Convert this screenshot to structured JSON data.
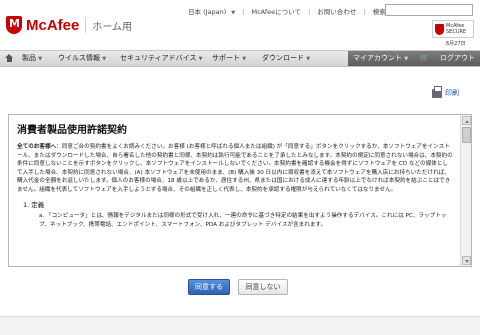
{
  "top_links": {
    "region": "日本 (Japan)",
    "about": "McAfeeについて",
    "contact": "お問い合わせ",
    "search_label": "検索"
  },
  "header": {
    "brand": "McAfee",
    "brand_sub": "ホーム用",
    "secure_line1": "McAfee",
    "secure_line2": "SECURE",
    "secure_date": "6月27日"
  },
  "nav": {
    "items": [
      "製品",
      "ウイルス情報",
      "セキュリティアドバイス",
      "サポート",
      "ダウンロード"
    ],
    "my_account": "マイアカウント",
    "login": "ログアウト"
  },
  "print_label": "印刷",
  "license": {
    "title": "消費者製品使用許諾契約",
    "para1_bold": "全てのお客様へ",
    "para1": "：同意ご合の契約書をよくお読みください。お客様 (お客様と呼ばれる個人または組織) が「同意する」ボタンをクリックするか、本ソフトウェアをインストール、またはダウンロードした場合、自ら署名した他の契約書と同様、本契約は執行可能であることを了承したとみなします。本契約の規定に同意されない場合は、本契約の条件に同意しないことを示すボタンをクリックし、本ソフトウェアをインストールしないでください。本契約書を確認する機会を得ずにソフトウェアを CD などの媒体として入手した場合、本契約に同意されない場合、(A) 本ソフトウェアを未使用のまま、(B) 購入後 30 日以内に領収書を添えて本ソフトウェアを購入店にお持ちいただければ、購入代金の全額をお返しいたします。個人のお客様の場合、18 歳以上であるか、居住する州、県または国における成人に達する年齢以上でなければ本契約を結ぶことはできません。組織を代表してソフトウェアを入手しようとする場合、その組織を正しく代表し、本契約を承認する権限が与えられていなくてはなりません。",
    "section1": "1.  定義",
    "item_a": "a. 「コンピュータ」とは、情報をデジタルまたは同様の形式で受け入れ、一連の命令に基づき特定の結果を出すよう操作するデバイス。これには PC、ラップトップ、ネットブック、携帯電話、エンドポイント、スマートフォン、PDA およびタブレット デバイスが含まれます。"
  },
  "buttons": {
    "agree": "同意する",
    "disagree": "同意しない"
  }
}
